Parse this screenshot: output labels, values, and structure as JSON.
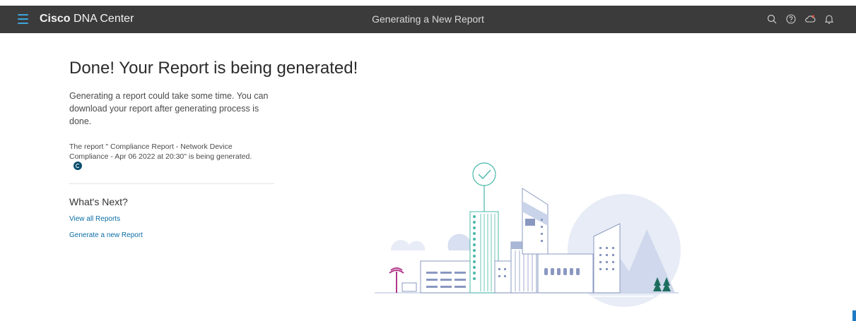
{
  "header": {
    "brand_bold": "Cisco",
    "brand_rest": "DNA Center",
    "page_title": "Generating a New Report",
    "icons": [
      "search-icon",
      "help-icon",
      "cloud-icon",
      "bell-icon"
    ]
  },
  "main": {
    "headline": "Done! Your Report is being generated!",
    "description": "Generating a report could take some time. You can download your report after generating process is done.",
    "status": "The report \" Compliance Report - Network Device Compliance - Apr 06 2022 at 20:30\" is being generated.",
    "next_title": "What's Next?",
    "links": {
      "view_all": "View all Reports",
      "generate_new": "Generate a new Report"
    }
  },
  "colors": {
    "topbar": "#3b3b3b",
    "accent": "#3ea5dc",
    "link": "#0b6ea8",
    "spinner": "#0a4d6e"
  }
}
